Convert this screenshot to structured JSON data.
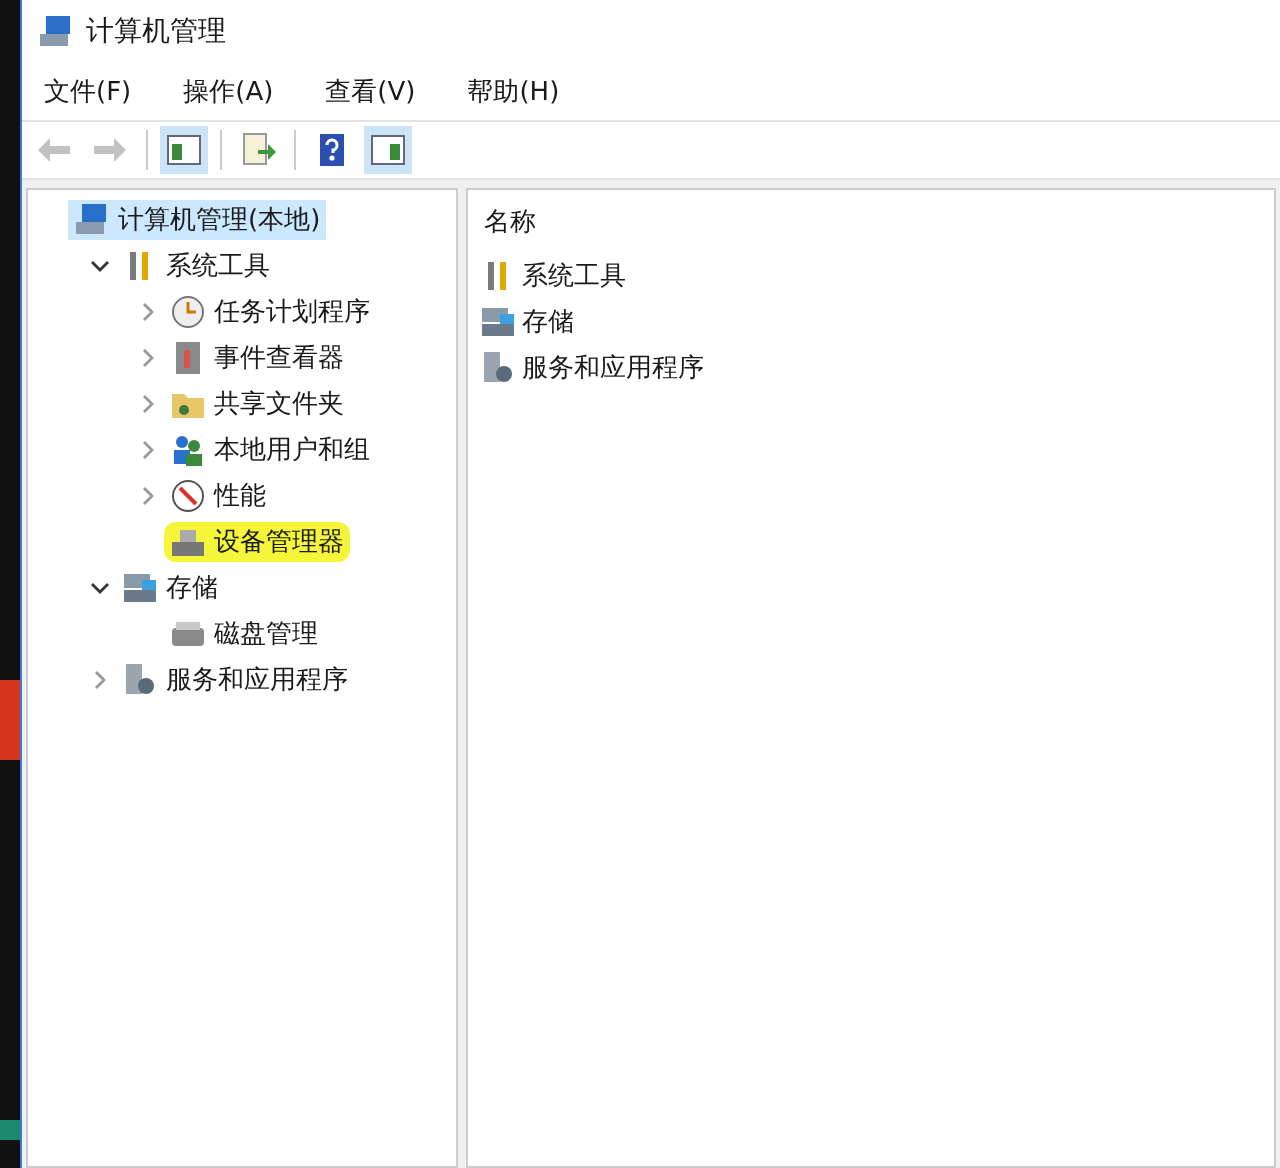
{
  "window": {
    "title": "计算机管理"
  },
  "menu": [
    {
      "label": "文件(F)"
    },
    {
      "label": "操作(A)"
    },
    {
      "label": "查看(V)"
    },
    {
      "label": "帮助(H)"
    }
  ],
  "toolbar": [
    {
      "kind": "back",
      "disabled": true,
      "pressed": false
    },
    {
      "kind": "forward",
      "disabled": true,
      "pressed": false
    },
    {
      "kind": "separator"
    },
    {
      "kind": "tree",
      "disabled": false,
      "pressed": true
    },
    {
      "kind": "separator"
    },
    {
      "kind": "export",
      "disabled": false,
      "pressed": false
    },
    {
      "kind": "separator"
    },
    {
      "kind": "help",
      "disabled": false,
      "pressed": false
    },
    {
      "kind": "action",
      "disabled": false,
      "pressed": true
    }
  ],
  "tree": [
    {
      "label": "计算机管理(本地)",
      "kind": "computer",
      "selected": true,
      "highlighted": false,
      "children": [
        {
          "label": "系统工具",
          "kind": "tools",
          "expanded": true,
          "selected": false,
          "highlighted": false,
          "children": [
            {
              "label": "任务计划程序",
              "kind": "clock",
              "expanded": false,
              "selected": false,
              "highlighted": false
            },
            {
              "label": "事件查看器",
              "kind": "event",
              "expanded": false,
              "selected": false,
              "highlighted": false
            },
            {
              "label": "共享文件夹",
              "kind": "folder",
              "expanded": false,
              "selected": false,
              "highlighted": false
            },
            {
              "label": "本地用户和组",
              "kind": "users",
              "expanded": false,
              "selected": false,
              "highlighted": false
            },
            {
              "label": "性能",
              "kind": "perf",
              "expanded": false,
              "selected": false,
              "highlighted": false
            },
            {
              "label": "设备管理器",
              "kind": "device",
              "selected": false,
              "highlighted": true
            }
          ]
        },
        {
          "label": "存储",
          "kind": "storage",
          "expanded": true,
          "selected": false,
          "highlighted": false,
          "children": [
            {
              "label": "磁盘管理",
              "kind": "disk",
              "selected": false,
              "highlighted": false
            }
          ]
        },
        {
          "label": "服务和应用程序",
          "kind": "services",
          "expanded": false,
          "selected": false,
          "highlighted": false
        }
      ]
    }
  ],
  "list": {
    "column": "名称",
    "items": [
      {
        "label": "系统工具",
        "kind": "tools"
      },
      {
        "label": "存储",
        "kind": "storage"
      },
      {
        "label": "服务和应用程序",
        "kind": "services"
      }
    ]
  }
}
